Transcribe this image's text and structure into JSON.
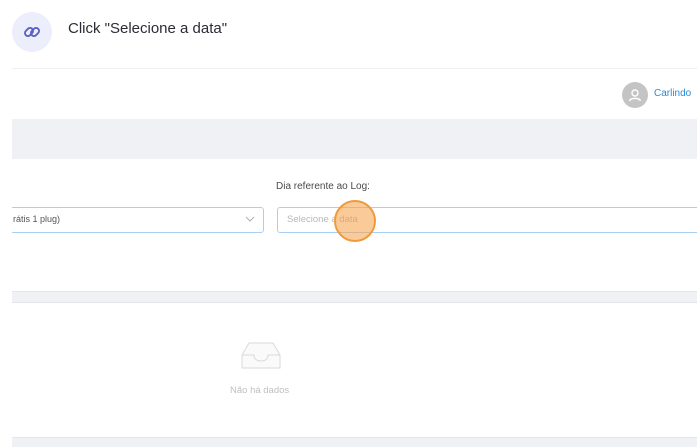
{
  "step": {
    "instruction": "Click \"Selecione a data\"",
    "icon": "link-icon"
  },
  "topbar": {
    "user_name": "Carlindo",
    "avatar_icon": "user-icon"
  },
  "form": {
    "left_select_value": "rátis 1 plug)",
    "date_label": "Dia referente ao Log:",
    "date_placeholder": "Selecione a data"
  },
  "empty_state": {
    "icon": "inbox-icon",
    "text": "Não há dados"
  },
  "colors": {
    "accent": "#2a8bd8",
    "marker": "#f09a3e",
    "band": "#f0f1f5"
  }
}
